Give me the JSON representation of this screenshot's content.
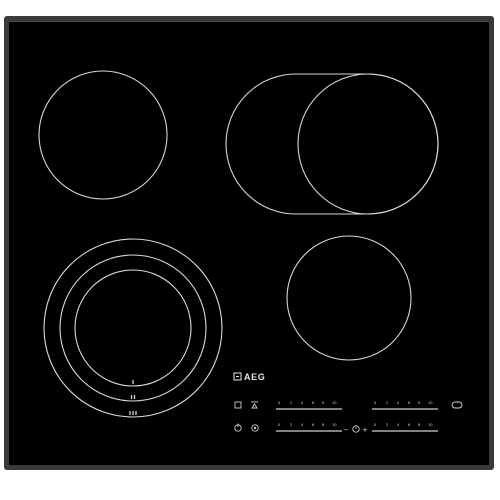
{
  "product": {
    "brand": "AEG",
    "type": "ceramic hob",
    "colors": {
      "frame": "#3a3a3a",
      "glass": "#000000",
      "ring_outline": "#d8d8d8",
      "print": "#e8e8e8",
      "background": "#ffffff"
    }
  },
  "cooking_zones": [
    {
      "id": "front-left",
      "kind": "triple-ring"
    },
    {
      "id": "rear-left",
      "kind": "single"
    },
    {
      "id": "rear-right",
      "kind": "dual-oval"
    },
    {
      "id": "front-right",
      "kind": "single"
    }
  ],
  "control_panel": {
    "icons": [
      "power-icon",
      "lock-icon",
      "timer-icon",
      "stop-go-icon",
      "bridge-icon",
      "triple-zone-icon",
      "oval-zone-icon"
    ],
    "sliders": [
      {
        "id": "slider-rear-left",
        "scale": [
          "0",
          "2",
          "4",
          "6",
          "8",
          "10"
        ]
      },
      {
        "id": "slider-rear-right",
        "scale": [
          "0",
          "2",
          "4",
          "6",
          "8",
          "10"
        ]
      },
      {
        "id": "slider-front-left",
        "scale": [
          "0",
          "2",
          "4",
          "6",
          "8",
          "10"
        ]
      },
      {
        "id": "slider-front-right",
        "scale": [
          "0",
          "2",
          "4",
          "6",
          "8",
          "10"
        ]
      }
    ],
    "timer_controls": {
      "minus": "−",
      "plus": "+"
    }
  }
}
